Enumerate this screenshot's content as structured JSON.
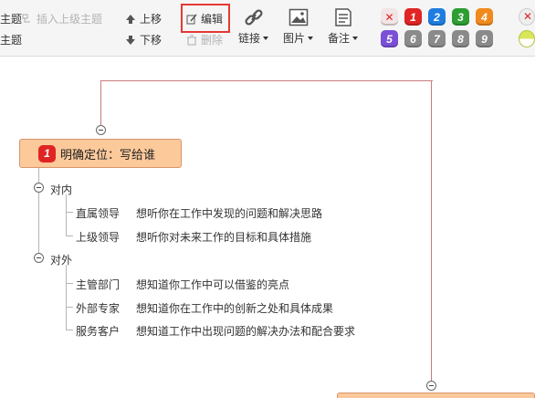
{
  "toolbar": {
    "row1": {
      "topic_partial": "主题",
      "insert_parent": "插入上级主题",
      "move_up": "上移",
      "edit": "编辑",
      "link": "链接",
      "image": "图片",
      "note": "备注"
    },
    "row2": {
      "topic_partial": "主题",
      "move_down": "下移",
      "delete": "删除"
    },
    "priority_row1": [
      "1",
      "2",
      "3",
      "4"
    ],
    "priority_row2": [
      "5",
      "6",
      "7",
      "8",
      "9"
    ],
    "priority_colors_row1": [
      "#e02424",
      "#1f7de0",
      "#2e9e33",
      "#f08a1c"
    ],
    "priority_colors_row2": [
      "#7a50d6",
      "#888888",
      "#888888",
      "#888888",
      "#888888"
    ]
  },
  "mindmap": {
    "main_topic": {
      "badge": "1",
      "label": "明确定位：写给谁"
    },
    "groups": [
      {
        "label": "对内",
        "items": [
          {
            "role": "直属领导",
            "desc": "想听你在工作中发现的问题和解决思路"
          },
          {
            "role": "上级领导",
            "desc": "想听你对未来工作的目标和具体措施"
          }
        ]
      },
      {
        "label": "对外",
        "items": [
          {
            "role": "主管部门",
            "desc": "想知道你工作中可以借鉴的亮点"
          },
          {
            "role": "外部专家",
            "desc": "想知道你在工作中的创新之处和具体成果"
          },
          {
            "role": "服务客户",
            "desc": "想知道工作中出现问题的解决办法和配合要求"
          }
        ]
      }
    ]
  },
  "colors": {
    "topic_fill": "#fcc99b",
    "branch_line": "#c97b7b",
    "highlight": "#e53935"
  }
}
